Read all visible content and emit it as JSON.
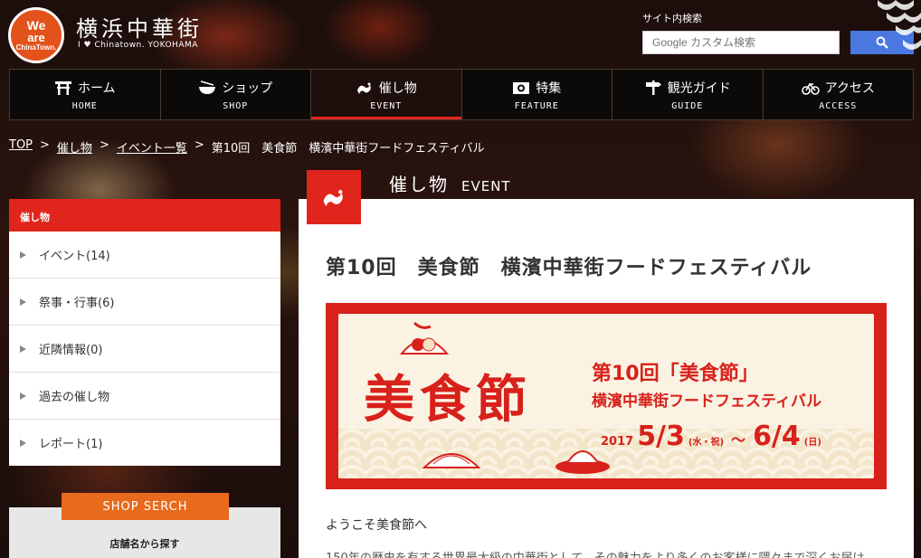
{
  "header": {
    "logo_line1": "We",
    "logo_line2": "are",
    "logo_line3": "ChinaTown.",
    "title": "横浜中華街",
    "subtitle": "I ♥ Chinatown. YOKOHAMA"
  },
  "search": {
    "label": "サイト内検索",
    "placeholder": "Google カスタム検索",
    "button_icon": "search-icon"
  },
  "nav": {
    "items": [
      {
        "label": "ホーム",
        "sub": "HOME",
        "icon": "gate-icon"
      },
      {
        "label": "ショップ",
        "sub": "SHOP",
        "icon": "bowl-icon"
      },
      {
        "label": "催し物",
        "sub": "EVENT",
        "icon": "dragon-icon"
      },
      {
        "label": "特集",
        "sub": "FEATURE",
        "icon": "camera-icon"
      },
      {
        "label": "観光ガイド",
        "sub": "GUIDE",
        "icon": "signpost-icon"
      },
      {
        "label": "アクセス",
        "sub": "ACCESS",
        "icon": "bicycle-icon"
      }
    ],
    "active_index": 2
  },
  "breadcrumb": {
    "items": [
      "TOP",
      "催し物",
      "イベント一覧",
      "第10回　美食節　横濱中華街フードフェスティバル"
    ],
    "separator": ">"
  },
  "sidebar": {
    "heading": "催し物",
    "items": [
      {
        "label": "イベント(14)"
      },
      {
        "label": "祭事・行事(6)"
      },
      {
        "label": "近隣情報(0)"
      },
      {
        "label": "過去の催し物"
      },
      {
        "label": "レポート(1)"
      }
    ],
    "shop_tab": "SHOP SERCH",
    "shop_sub": "店舗名から探す"
  },
  "main": {
    "section_jp": "催し物",
    "section_en": "EVENT",
    "article_title": "第10回　美食節　横濱中華街フードフェスティバル",
    "banner": {
      "kanji": "美食節",
      "line1": "第10回「美食節」",
      "line2": "横濱中華街フードフェスティバル",
      "year": "2017",
      "start": "5/3",
      "start_dow": "(水・祝)",
      "tilde": "～",
      "end": "6/4",
      "end_dow": "(日)"
    },
    "intro": "ようこそ美食節へ",
    "body": "150年の歴史を有する世界最大級の中華街として、その魅力をより多くのお客様に隈々まで深くお届け"
  },
  "colors": {
    "accent_red": "#e0251d",
    "search_blue": "#4a78e0",
    "shop_orange": "#e86a1c"
  }
}
